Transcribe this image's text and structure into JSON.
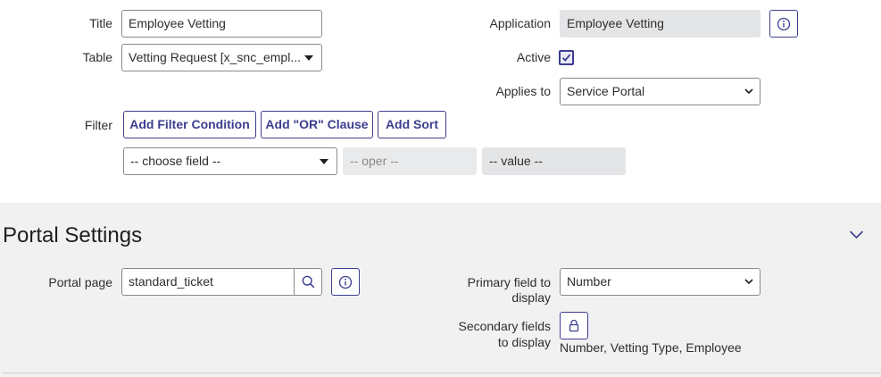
{
  "form": {
    "title_label": "Title",
    "title_value": "Employee Vetting",
    "table_label": "Table",
    "table_value": "Vetting Request [x_snc_empl...",
    "application_label": "Application",
    "application_value": "Employee Vetting",
    "active_label": "Active",
    "active_checked": true,
    "applies_to_label": "Applies to",
    "applies_to_value": "Service Portal",
    "filter_label": "Filter",
    "filter_buttons": [
      "Add Filter Condition",
      "Add \"OR\" Clause",
      "Add Sort"
    ],
    "choose_field_value": "-- choose field --",
    "oper_value": "-- oper --",
    "value_value": "-- value --"
  },
  "portal_settings": {
    "title": "Portal Settings",
    "portal_page_label": "Portal page",
    "portal_page_value": "standard_ticket",
    "primary_field_label_line1": "Primary field to",
    "primary_field_label_line2": "display",
    "primary_field_value": "Number",
    "secondary_fields_label_line1": "Secondary fields",
    "secondary_fields_label_line2": "to display",
    "secondary_fields_value": "Number, Vetting Type, Employee"
  },
  "icons": {
    "info": "info-circle-icon",
    "search": "search-icon",
    "lock": "lock-icon",
    "collapse": "chevron-down-icon",
    "check": "check-icon"
  },
  "colors": {
    "accent": "#3c3e8f",
    "section_bg": "#f1f1f2",
    "readonly_bg": "#e4e5e7"
  }
}
